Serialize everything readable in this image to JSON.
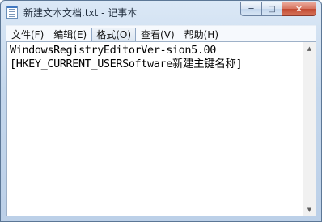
{
  "window": {
    "title": "新建文本文档.txt - 记事本",
    "minimize_glyph": "─",
    "maximize_glyph": "□",
    "close_glyph": "✕"
  },
  "menu": [
    {
      "label": "文件(F)"
    },
    {
      "label": "编辑(E)"
    },
    {
      "label": "格式(O)"
    },
    {
      "label": "查看(V)"
    },
    {
      "label": "帮助(H)"
    }
  ],
  "editor": {
    "lines": [
      "WindowsRegistryEditorVer-sion5.00",
      "[HKEY_CURRENT_USERSoftware新建主键名称]"
    ]
  },
  "scrollbar": {
    "up_glyph": "▲",
    "down_glyph": "▼"
  },
  "colors": {
    "frame": "#c4d7ec",
    "close_button": "#c24a32",
    "menu_bg": "#f6f9fd"
  }
}
